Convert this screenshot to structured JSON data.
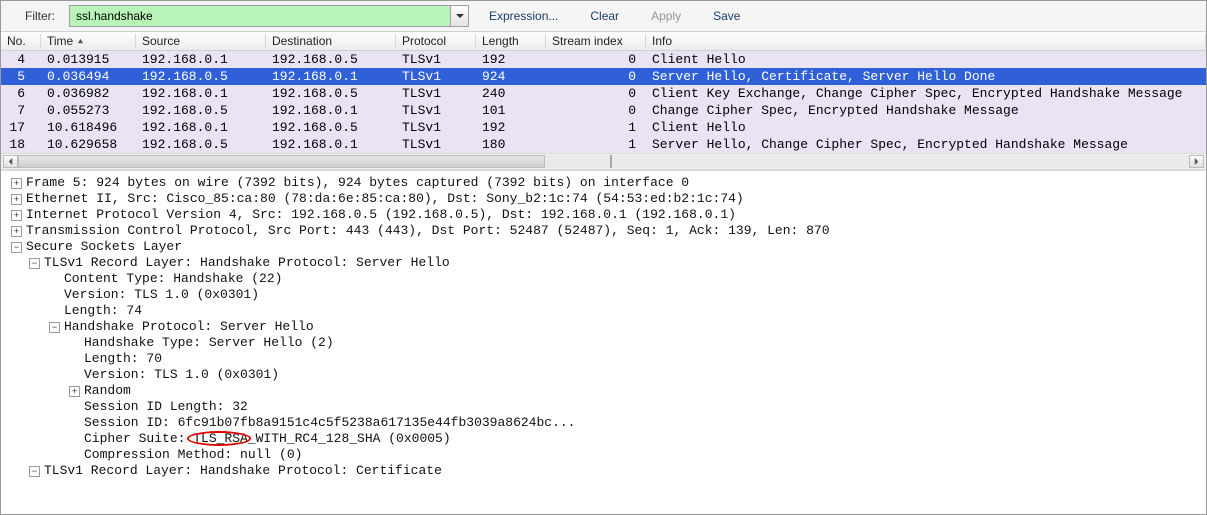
{
  "filter": {
    "label": "Filter:",
    "value": "ssl.handshake",
    "expression": "Expression...",
    "clear": "Clear",
    "apply": "Apply",
    "save": "Save"
  },
  "columns": {
    "no": "No.",
    "time": "Time",
    "source": "Source",
    "destination": "Destination",
    "protocol": "Protocol",
    "length": "Length",
    "stream": "Stream index",
    "info": "Info"
  },
  "packets": [
    {
      "no": "4",
      "time": "0.013915",
      "src": "192.168.0.1",
      "dst": "192.168.0.5",
      "proto": "TLSv1",
      "len": "192",
      "si": "0",
      "info": "Client Hello",
      "sel": false
    },
    {
      "no": "5",
      "time": "0.036494",
      "src": "192.168.0.5",
      "dst": "192.168.0.1",
      "proto": "TLSv1",
      "len": "924",
      "si": "0",
      "info": "Server Hello, Certificate, Server Hello Done",
      "sel": true
    },
    {
      "no": "6",
      "time": "0.036982",
      "src": "192.168.0.1",
      "dst": "192.168.0.5",
      "proto": "TLSv1",
      "len": "240",
      "si": "0",
      "info": "Client Key Exchange, Change Cipher Spec, Encrypted Handshake Message",
      "sel": false
    },
    {
      "no": "7",
      "time": "0.055273",
      "src": "192.168.0.5",
      "dst": "192.168.0.1",
      "proto": "TLSv1",
      "len": "101",
      "si": "0",
      "info": "Change Cipher Spec, Encrypted Handshake Message",
      "sel": false
    },
    {
      "no": "17",
      "time": "10.618496",
      "src": "192.168.0.1",
      "dst": "192.168.0.5",
      "proto": "TLSv1",
      "len": "192",
      "si": "1",
      "info": "Client Hello",
      "sel": false
    },
    {
      "no": "18",
      "time": "10.629658",
      "src": "192.168.0.5",
      "dst": "192.168.0.1",
      "proto": "TLSv1",
      "len": "180",
      "si": "1",
      "info": "Server Hello, Change Cipher Spec, Encrypted Handshake Message",
      "sel": false
    }
  ],
  "details": [
    {
      "ind": 0,
      "tgl": "+",
      "text": "Frame 5: 924 bytes on wire (7392 bits), 924 bytes captured (7392 bits) on interface 0"
    },
    {
      "ind": 0,
      "tgl": "+",
      "text": "Ethernet II, Src: Cisco_85:ca:80 (78:da:6e:85:ca:80), Dst: Sony_b2:1c:74 (54:53:ed:b2:1c:74)"
    },
    {
      "ind": 0,
      "tgl": "+",
      "text": "Internet Protocol Version 4, Src: 192.168.0.5 (192.168.0.5), Dst: 192.168.0.1 (192.168.0.1)"
    },
    {
      "ind": 0,
      "tgl": "+",
      "text": "Transmission Control Protocol, Src Port: 443 (443), Dst Port: 52487 (52487), Seq: 1, Ack: 139, Len: 870"
    },
    {
      "ind": 0,
      "tgl": "-",
      "text": "Secure Sockets Layer"
    },
    {
      "ind": 1,
      "tgl": "-",
      "text": "TLSv1 Record Layer: Handshake Protocol: Server Hello"
    },
    {
      "ind": 2,
      "tgl": "",
      "text": "Content Type: Handshake (22)"
    },
    {
      "ind": 2,
      "tgl": "",
      "text": "Version: TLS 1.0 (0x0301)"
    },
    {
      "ind": 2,
      "tgl": "",
      "text": "Length: 74"
    },
    {
      "ind": 2,
      "tgl": "-",
      "text": "Handshake Protocol: Server Hello"
    },
    {
      "ind": 3,
      "tgl": "",
      "text": "Handshake Type: Server Hello (2)"
    },
    {
      "ind": 3,
      "tgl": "",
      "text": "Length: 70"
    },
    {
      "ind": 3,
      "tgl": "",
      "text": "Version: TLS 1.0 (0x0301)"
    },
    {
      "ind": 3,
      "tgl": "+",
      "text": "Random"
    },
    {
      "ind": 3,
      "tgl": "",
      "text": "Session ID Length: 32"
    },
    {
      "ind": 3,
      "tgl": "",
      "text": "Session ID: 6fc91b07fb8a9151c4c5f5238a617135e44fb3039a8624bc..."
    },
    {
      "ind": 3,
      "tgl": "",
      "text": "Cipher Suite: TLS_RSA_WITH_RC4_128_SHA (0x0005)"
    },
    {
      "ind": 3,
      "tgl": "",
      "text": "Compression Method: null (0)"
    },
    {
      "ind": 1,
      "tgl": "-",
      "text": "TLSv1 Record Layer: Handshake Protocol: Certificate"
    }
  ]
}
